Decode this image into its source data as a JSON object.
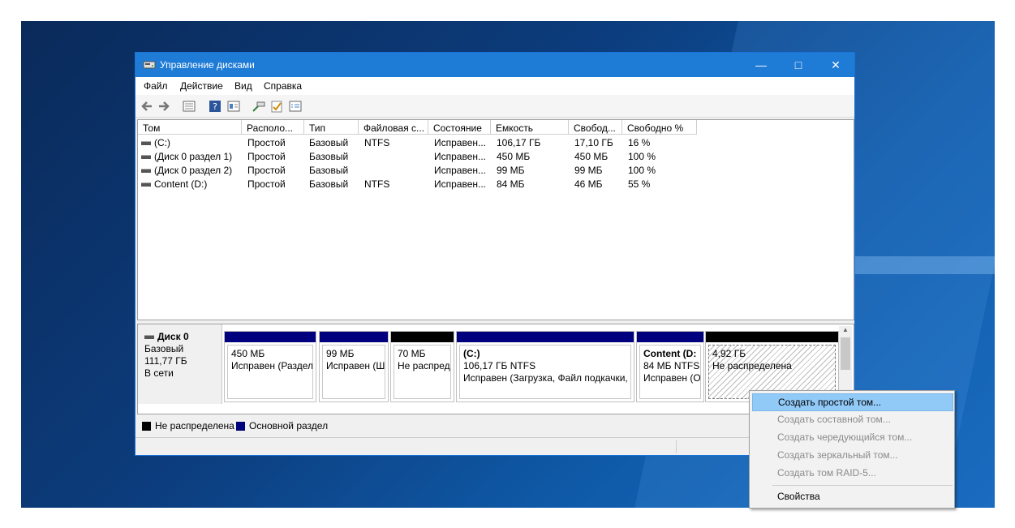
{
  "window": {
    "title": "Управление дисками"
  },
  "menu": [
    "Файл",
    "Действие",
    "Вид",
    "Справка"
  ],
  "volume_table": {
    "headers": [
      "Том",
      "Располо...",
      "Тип",
      "Файловая с...",
      "Состояние",
      "Емкость",
      "Свобод...",
      "Свободно %"
    ],
    "rows": [
      [
        "(C:)",
        "Простой",
        "Базовый",
        "NTFS",
        "Исправен...",
        "106,17 ГБ",
        "17,10 ГБ",
        "16 %"
      ],
      [
        "(Диск 0 раздел 1)",
        "Простой",
        "Базовый",
        "",
        "Исправен...",
        "450 МБ",
        "450 МБ",
        "100 %"
      ],
      [
        "(Диск 0 раздел 2)",
        "Простой",
        "Базовый",
        "",
        "Исправен...",
        "99 МБ",
        "99 МБ",
        "100 %"
      ],
      [
        "Content (D:)",
        "Простой",
        "Базовый",
        "NTFS",
        "Исправен...",
        "84 МБ",
        "46 МБ",
        "55 %"
      ]
    ]
  },
  "disk": {
    "name": "Диск 0",
    "type": "Базовый",
    "size": "111,77 ГБ",
    "status": "В сети"
  },
  "partitions": [
    {
      "title": "",
      "line1": "450 МБ",
      "line2": "Исправен (Раздел",
      "kind": "primary"
    },
    {
      "title": "",
      "line1": "99 МБ",
      "line2": "Исправен (Ш",
      "kind": "primary"
    },
    {
      "title": "",
      "line1": "70 МБ",
      "line2": "Не распреде",
      "kind": "unallocated"
    },
    {
      "title": "(C:)",
      "line1": "106,17 ГБ NTFS",
      "line2": "Исправен (Загрузка, Файл подкачки, .",
      "kind": "primary"
    },
    {
      "title": "Content (D:",
      "line1": "84 МБ NTFS",
      "line2": "Исправен (О",
      "kind": "primary"
    },
    {
      "title": "",
      "line1": "4,92 ГБ",
      "line2": "Не распределена",
      "kind": "unallocated-selected"
    }
  ],
  "legend": {
    "unallocated": "Не распределена",
    "primary": "Основной раздел"
  },
  "context_menu": {
    "items": [
      {
        "label": "Создать простой том...",
        "state": "highlighted"
      },
      {
        "label": "Создать составной том...",
        "state": "disabled"
      },
      {
        "label": "Создать чередующийся том...",
        "state": "disabled"
      },
      {
        "label": "Создать зеркальный том...",
        "state": "disabled"
      },
      {
        "label": "Создать том RAID-5...",
        "state": "disabled"
      }
    ],
    "properties": "Свойства"
  },
  "colors": {
    "titlebar": "#1e7bd6",
    "primary": "#00007f",
    "unallocated": "#000000",
    "highlight": "#91c9f7"
  }
}
